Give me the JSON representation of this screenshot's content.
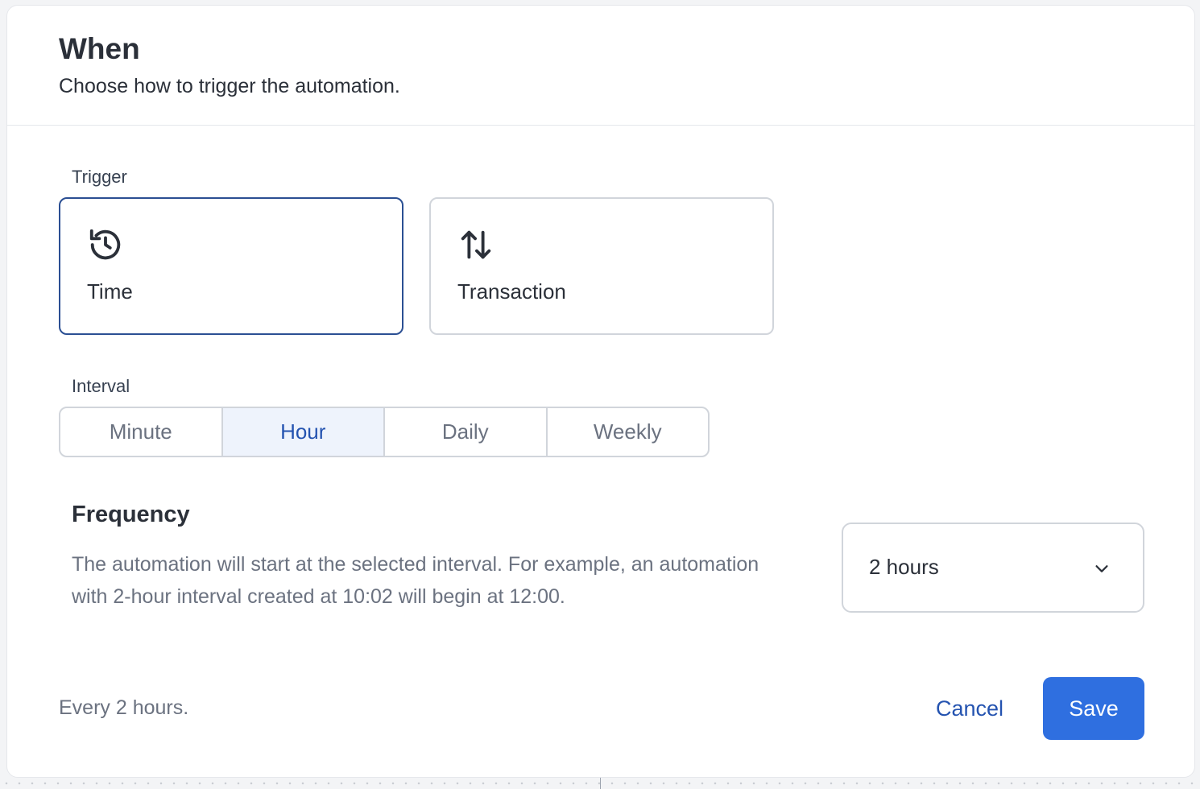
{
  "dialog": {
    "title": "When",
    "subtitle": "Choose how to trigger the automation."
  },
  "trigger": {
    "label": "Trigger",
    "options": [
      {
        "label": "Time",
        "icon": "clock-history-icon",
        "selected": true
      },
      {
        "label": "Transaction",
        "icon": "arrows-up-down-icon",
        "selected": false
      }
    ]
  },
  "interval": {
    "label": "Interval",
    "options": [
      "Minute",
      "Hour",
      "Daily",
      "Weekly"
    ],
    "selected": "Hour"
  },
  "frequency": {
    "title": "Frequency",
    "description": "The automation will start at the selected interval. For example, an automation with 2-hour interval created at 10:02 will begin at 12:00.",
    "select_value": "2 hours",
    "chevron_icon": "chevron-down-icon"
  },
  "footer": {
    "summary": "Every 2 hours.",
    "cancel_label": "Cancel",
    "save_label": "Save"
  },
  "colors": {
    "accent": "#2f6fe0",
    "selected_border": "#2b4f93",
    "link": "#2453b0"
  }
}
